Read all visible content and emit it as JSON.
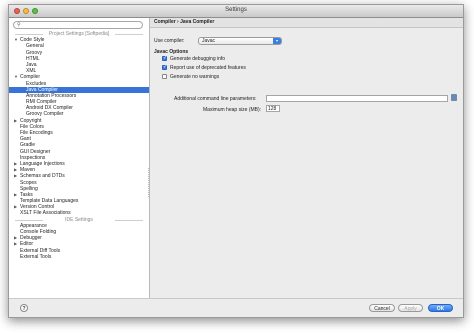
{
  "window": {
    "title": "Settings"
  },
  "search": {
    "placeholder": ""
  },
  "sections": {
    "project": "Project Settings [Softpedia]",
    "ide": "IDE Settings"
  },
  "tree": {
    "project_items": [
      {
        "label": "Code Style",
        "level": 0,
        "arrow": "down"
      },
      {
        "label": "General",
        "level": 1
      },
      {
        "label": "Groovy",
        "level": 1
      },
      {
        "label": "HTML",
        "level": 1
      },
      {
        "label": "Java",
        "level": 1
      },
      {
        "label": "XML",
        "level": 1
      },
      {
        "label": "Compiler",
        "level": 0,
        "arrow": "down"
      },
      {
        "label": "Excludes",
        "level": 1
      },
      {
        "label": "Java Compiler",
        "level": 1,
        "selected": true
      },
      {
        "label": "Annotation Processors",
        "level": 1
      },
      {
        "label": "RMI Compiler",
        "level": 1
      },
      {
        "label": "Android DX Compiler",
        "level": 1
      },
      {
        "label": "Groovy Compiler",
        "level": 1
      },
      {
        "label": "Copyright",
        "level": 0,
        "arrow": "right"
      },
      {
        "label": "File Colors",
        "level": 0
      },
      {
        "label": "File Encodings",
        "level": 0
      },
      {
        "label": "Gant",
        "level": 0
      },
      {
        "label": "Gradle",
        "level": 0
      },
      {
        "label": "GUI Designer",
        "level": 0
      },
      {
        "label": "Inspections",
        "level": 0
      },
      {
        "label": "Language Injections",
        "level": 0,
        "arrow": "right"
      },
      {
        "label": "Maven",
        "level": 0,
        "arrow": "right"
      },
      {
        "label": "Schemas and DTDs",
        "level": 0,
        "arrow": "right"
      },
      {
        "label": "Scopes",
        "level": 0
      },
      {
        "label": "Spelling",
        "level": 0
      },
      {
        "label": "Tasks",
        "level": 0,
        "arrow": "right"
      },
      {
        "label": "Template Data Languages",
        "level": 0
      },
      {
        "label": "Version Control",
        "level": 0,
        "arrow": "right"
      },
      {
        "label": "XSLT File Associations",
        "level": 0
      }
    ],
    "ide_items": [
      {
        "label": "Appearance",
        "level": 0
      },
      {
        "label": "Console Folding",
        "level": 0
      },
      {
        "label": "Debugger",
        "level": 0,
        "arrow": "right"
      },
      {
        "label": "Editor",
        "level": 0,
        "arrow": "right"
      },
      {
        "label": "External Diff Tools",
        "level": 0
      },
      {
        "label": "External Tools",
        "level": 0
      }
    ]
  },
  "panel": {
    "header": "Compiler › Java Compiler",
    "use_compiler_label": "Use compiler:",
    "compiler_value": "Javac",
    "javac_options_label": "Javac Options",
    "options": [
      {
        "label": "Generate debugging info",
        "checked": true
      },
      {
        "label": "Report use of deprecated features",
        "checked": true
      },
      {
        "label": "Generate no warnings",
        "checked": false
      }
    ],
    "additional_params_label": "Additional command line parameters:",
    "additional_params_value": "",
    "heap_label": "Maximum heap size (MB):",
    "heap_value": "128"
  },
  "buttons": {
    "help": "?",
    "cancel": "Cancel",
    "apply": "Apply",
    "ok": "OK"
  }
}
